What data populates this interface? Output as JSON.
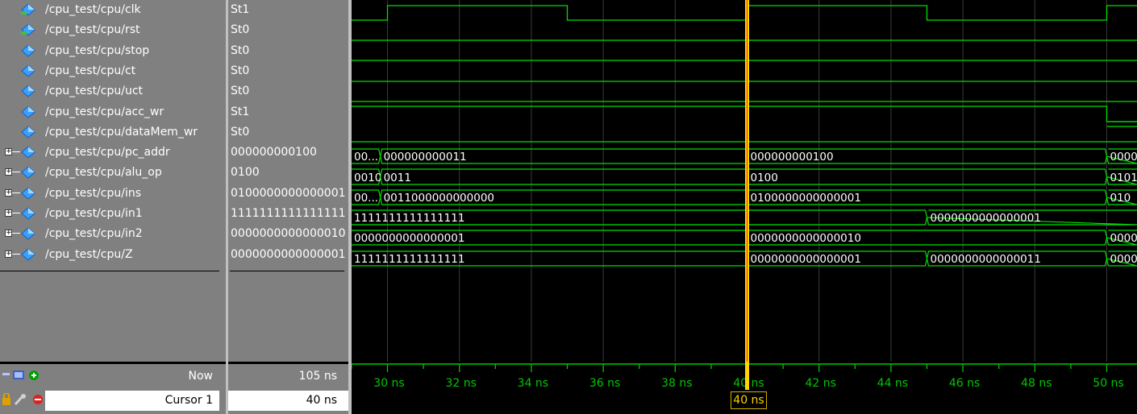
{
  "signals": [
    {
      "name": "/cpu_test/cpu/clk",
      "value": "St1",
      "icon": "signal-clock-icon",
      "expandable": false
    },
    {
      "name": "/cpu_test/cpu/rst",
      "value": "St0",
      "icon": "signal-clock-icon",
      "expandable": false
    },
    {
      "name": "/cpu_test/cpu/stop",
      "value": "St0",
      "icon": "signal-diamond-icon",
      "expandable": false
    },
    {
      "name": "/cpu_test/cpu/ct",
      "value": "St0",
      "icon": "signal-diamond-icon",
      "expandable": false
    },
    {
      "name": "/cpu_test/cpu/uct",
      "value": "St0",
      "icon": "signal-diamond-icon",
      "expandable": false
    },
    {
      "name": "/cpu_test/cpu/acc_wr",
      "value": "St1",
      "icon": "signal-diamond-icon",
      "expandable": false
    },
    {
      "name": "/cpu_test/cpu/dataMem_wr",
      "value": "St0",
      "icon": "signal-diamond-icon",
      "expandable": false
    },
    {
      "name": "/cpu_test/cpu/pc_addr",
      "value": "000000000100",
      "icon": "signal-diamond-icon",
      "expandable": true
    },
    {
      "name": "/cpu_test/cpu/alu_op",
      "value": "0100",
      "icon": "signal-diamond-icon",
      "expandable": true
    },
    {
      "name": "/cpu_test/cpu/ins",
      "value": "0100000000000001",
      "icon": "signal-diamond-icon",
      "expandable": true
    },
    {
      "name": "/cpu_test/cpu/in1",
      "value": "1111111111111111",
      "icon": "signal-diamond-icon",
      "expandable": true
    },
    {
      "name": "/cpu_test/cpu/in2",
      "value": "0000000000000010",
      "icon": "signal-diamond-icon",
      "expandable": true
    },
    {
      "name": "/cpu_test/cpu/Z",
      "value": "0000000000000001",
      "icon": "signal-diamond-icon",
      "expandable": true
    }
  ],
  "buses": {
    "pc_addr": [
      "00...",
      "000000000011",
      "000000000100",
      "0000"
    ],
    "alu_op": [
      "0010",
      "0011",
      "0100",
      "0101"
    ],
    "ins": [
      "00...",
      "0011000000000000",
      "0100000000000001",
      "010"
    ],
    "in1": [
      "1111111111111111",
      "0000000000000001"
    ],
    "in2": [
      "0000000000000001",
      "0000000000000010",
      "0000"
    ],
    "Z": [
      "1111111111111111",
      "0000000000000001",
      "0000000000000011",
      "0000"
    ]
  },
  "footer": {
    "now_label": "Now",
    "now_value": "105 ns",
    "cursor_label": "Cursor 1",
    "cursor_value": "40 ns",
    "cursor_flag": "40 ns"
  },
  "timeline": {
    "ticks": [
      "30 ns",
      "32 ns",
      "34 ns",
      "36 ns",
      "38 ns",
      "40 ns",
      "42 ns",
      "44 ns",
      "46 ns",
      "48 ns",
      "50 ns"
    ]
  },
  "colors": {
    "wave": "#00e000",
    "cursor": "#ffd400",
    "cursor_core": "#ff2000",
    "grid": "#3a3a3a"
  }
}
